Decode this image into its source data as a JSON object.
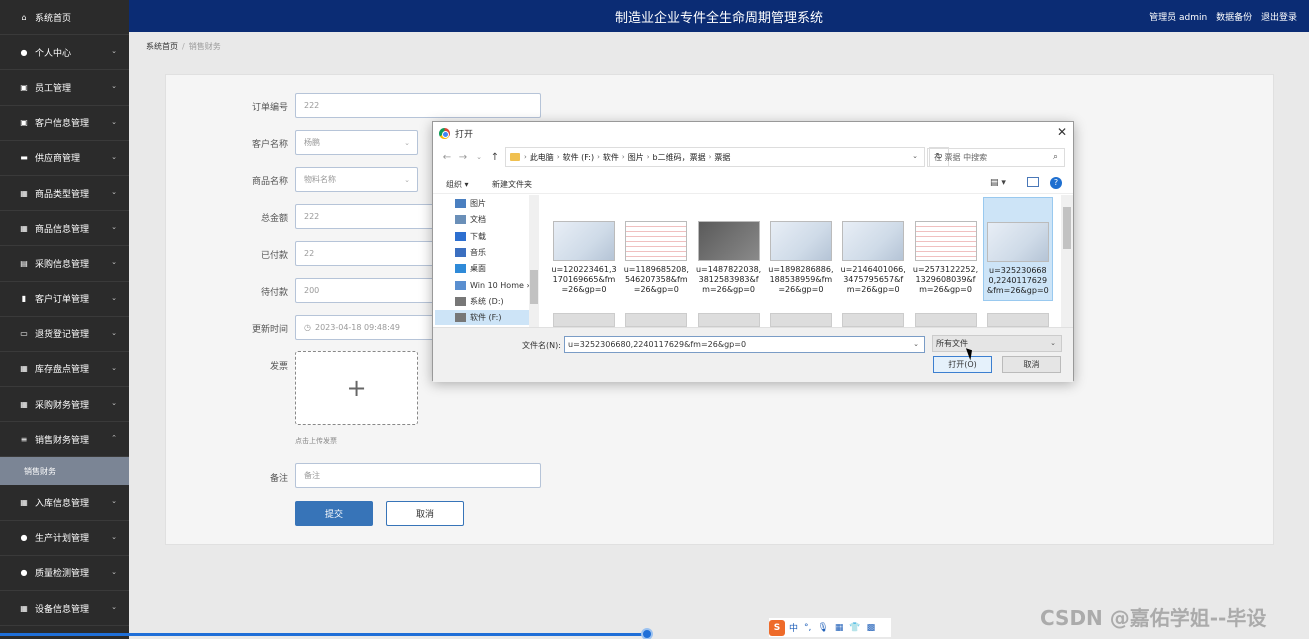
{
  "sidebar": {
    "items": [
      {
        "label": "系统首页",
        "icon": "home-icon",
        "expand": false
      },
      {
        "label": "个人中心",
        "icon": "user-icon",
        "expand": true
      },
      {
        "label": "员工管理",
        "icon": "briefcase-icon",
        "expand": true
      },
      {
        "label": "客户信息管理",
        "icon": "briefcase-icon",
        "expand": true
      },
      {
        "label": "供应商管理",
        "icon": "chat-icon",
        "expand": true
      },
      {
        "label": "商品类型管理",
        "icon": "grid-icon",
        "expand": true
      },
      {
        "label": "商品信息管理",
        "icon": "grid-icon",
        "expand": true
      },
      {
        "label": "采购信息管理",
        "icon": "document-icon",
        "expand": true
      },
      {
        "label": "客户订单管理",
        "icon": "chart-icon",
        "expand": true
      },
      {
        "label": "退货登记管理",
        "icon": "screen-icon",
        "expand": true
      },
      {
        "label": "库存盘点管理",
        "icon": "grid-icon",
        "expand": true
      },
      {
        "label": "采购财务管理",
        "icon": "grid-icon",
        "expand": true
      },
      {
        "label": "销售财务管理",
        "icon": "list-icon",
        "expand": true,
        "open": true
      }
    ],
    "sub_item": "销售财务",
    "items_after": [
      {
        "label": "入库信息管理",
        "icon": "grid-icon",
        "expand": true
      },
      {
        "label": "生产计划管理",
        "icon": "pin-icon",
        "expand": true
      },
      {
        "label": "质量检测管理",
        "icon": "user-icon",
        "expand": true
      },
      {
        "label": "设备信息管理",
        "icon": "grid-icon",
        "expand": true
      }
    ]
  },
  "header": {
    "title": "制造业企业专件全生命周期管理系统",
    "user": "管理员 admin",
    "backup": "数据备份",
    "logout": "退出登录"
  },
  "breadcrumb": {
    "home": "系统首页",
    "current": "销售财务"
  },
  "form": {
    "order_no_label": "订单编号",
    "order_no": "222",
    "customer_label": "客户名称",
    "customer": "杨鹏",
    "product_label": "商品名称",
    "product_placeholder": "物料名称",
    "total_label": "总金额",
    "total": "222",
    "paid_label": "已付款",
    "paid": "22",
    "pending_label": "待付款",
    "pending": "200",
    "updated_label": "更新时间",
    "updated": "2023-04-18 09:48:49",
    "invoice_label": "发票",
    "upload_hint": "点击上传发票",
    "remark_label": "备注",
    "remark_placeholder": "备注",
    "submit": "提交",
    "cancel": "取消"
  },
  "dialog": {
    "title": "打开",
    "path": [
      "此电脑",
      "软件 (F:)",
      "软件",
      "图片",
      "b二维码，票据",
      "票据"
    ],
    "search_placeholder": "在 票据 中搜索",
    "organize": "组织 ▾",
    "new_folder": "新建文件夹",
    "tree": [
      "图片",
      "文档",
      "下载",
      "音乐",
      "桌面",
      "Win 10 Home ›",
      "系统 (D:)",
      "软件 (F:)"
    ],
    "files": [
      "u=120223461,3170169665&fm=26&gp=0",
      "u=1189685208,546207358&fm=26&gp=0",
      "u=1487822038,3812583983&fm=26&gp=0",
      "u=1898286886,188538959&fm=26&gp=0",
      "u=2146401066,3475795657&fm=26&gp=0",
      "u=2573122252,1329608039&fm=26&gp=0",
      "u=3252306680,2240117629&fm=26&gp=0"
    ],
    "filename_label": "文件名(N):",
    "filename": "u=3252306680,2240117629&fm=26&gp=0",
    "filetype": "所有文件",
    "open": "打开(O)",
    "cancel": "取消"
  },
  "ime": {
    "lang": "中"
  },
  "watermark": "CSDN @嘉佑学姐--毕设"
}
